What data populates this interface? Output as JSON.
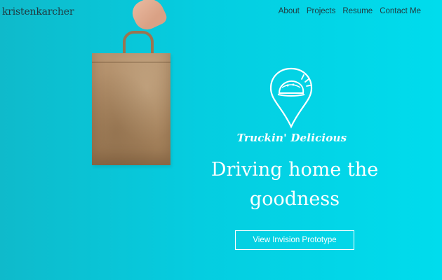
{
  "header": {
    "logo": "kristenkarcher",
    "nav": [
      {
        "label": "About"
      },
      {
        "label": "Projects"
      },
      {
        "label": "Resume"
      },
      {
        "label": "Contact Me"
      }
    ]
  },
  "hero": {
    "brand": "Truckin' Delicious",
    "headline": "Driving home the goodness",
    "cta_label": "View Invision Prototype",
    "icon": "taco-pin-icon",
    "image": "paper-bag-photo"
  },
  "colors": {
    "background_start": "#0fbacb",
    "background_end": "#00dced",
    "nav_text": "#1f3a40",
    "hero_text": "#ffffff"
  }
}
